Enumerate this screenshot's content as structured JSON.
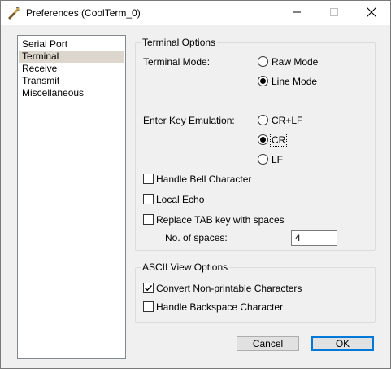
{
  "window": {
    "title": "Preferences (CoolTerm_0)"
  },
  "titlebar_icons": {
    "app": "coolterm-app-icon",
    "minimize": "minimize-icon",
    "maximize": "maximize-icon",
    "close": "close-icon"
  },
  "sidebar": {
    "items": [
      {
        "label": "Serial Port",
        "selected": false
      },
      {
        "label": "Terminal",
        "selected": true
      },
      {
        "label": "Receive",
        "selected": false
      },
      {
        "label": "Transmit",
        "selected": false
      },
      {
        "label": "Miscellaneous",
        "selected": false
      }
    ]
  },
  "terminal_options": {
    "legend": "Terminal Options",
    "terminal_mode": {
      "label": "Terminal Mode:",
      "options": [
        "Raw Mode",
        "Line Mode"
      ],
      "selected": "Line Mode"
    },
    "enter_key": {
      "label": "Enter Key Emulation:",
      "options": [
        "CR+LF",
        "CR",
        "LF"
      ],
      "selected": "CR"
    },
    "handle_bell": {
      "label": "Handle Bell Character",
      "checked": false
    },
    "local_echo": {
      "label": "Local Echo",
      "checked": false
    },
    "replace_tab": {
      "label": "Replace TAB key with spaces",
      "checked": false
    },
    "num_spaces": {
      "label": "No. of spaces:",
      "value": "4"
    }
  },
  "ascii_view": {
    "legend": "ASCII View Options",
    "convert_nonprintable": {
      "label": "Convert Non-printable Characters",
      "checked": true
    },
    "handle_backspace": {
      "label": "Handle Backspace Character",
      "checked": false
    }
  },
  "buttons": {
    "cancel": "Cancel",
    "ok": "OK"
  },
  "colors": {
    "selected_item_bg": "#ddd6cc",
    "default_button_border": "#0078d7"
  }
}
